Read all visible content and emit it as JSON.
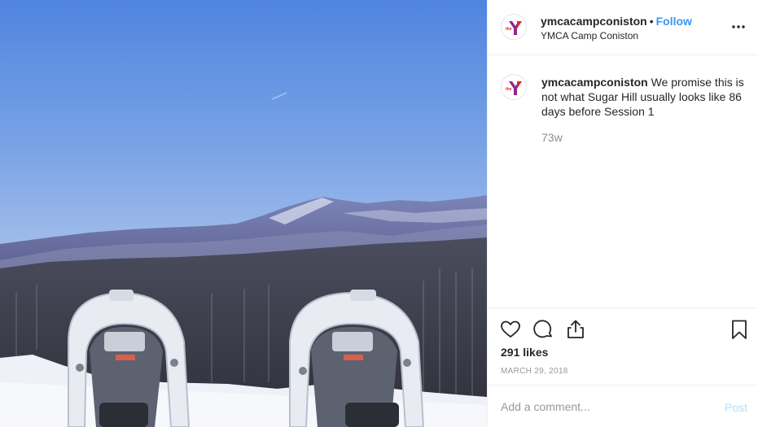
{
  "post": {
    "photo_icon": "snowshoes-mountain-photo",
    "header": {
      "username": "ymcacampconiston",
      "separator": "•",
      "follow_label": "Follow",
      "location": "YMCA Camp Coniston",
      "avatar_icon": "ymca-logo-icon",
      "more_icon": "more-options-icon"
    },
    "caption": {
      "username": "ymcacampconiston",
      "text": "We promise this is not what Sugar Hill usually looks like 86 days before Session 1",
      "time_ago": "73w"
    },
    "actions": {
      "like_icon": "heart-icon",
      "comment_icon": "comment-icon",
      "share_icon": "share-icon",
      "save_icon": "bookmark-icon"
    },
    "likes": "291 likes",
    "date": "MARCH 29, 2018",
    "comment_box": {
      "placeholder": "Add a comment...",
      "post_label": "Post"
    },
    "colors": {
      "follow": "#3897f0",
      "post_disabled": "#b2dffc",
      "ymca_red": "#e5242d",
      "ymca_purple": "#92278f"
    }
  }
}
